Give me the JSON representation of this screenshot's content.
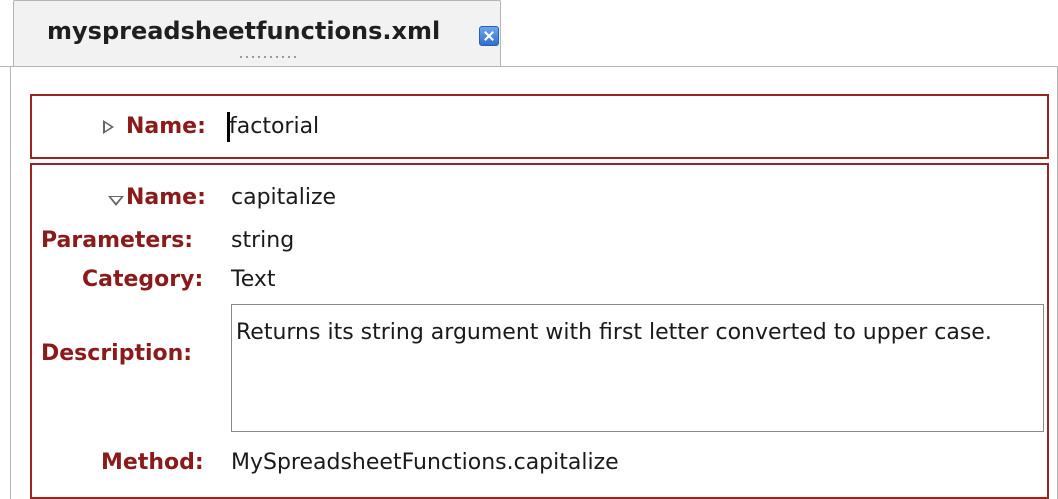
{
  "tab": {
    "filename": "myspreadsheetfunctions.xml",
    "close_icon": "close-icon"
  },
  "functions": [
    {
      "expanded": false,
      "name_label": "Name:",
      "name": "factorial",
      "toggle_icon": "expand-triangle-icon"
    },
    {
      "expanded": true,
      "name_label": "Name:",
      "name": "capitalize",
      "parameters_label": "Parameters:",
      "parameters": "string",
      "category_label": "Category:",
      "category": "Text",
      "description_label": "Description:",
      "description": "Returns its string argument with first letter converted to upper case.",
      "method_label": "Method:",
      "method": "MySpreadsheetFunctions.capitalize",
      "toggle_icon": "collapse-triangle-icon"
    }
  ],
  "colors": {
    "label": "#8b1a1a",
    "border": "#9b2323",
    "tab_close": "#2f6fd0"
  }
}
